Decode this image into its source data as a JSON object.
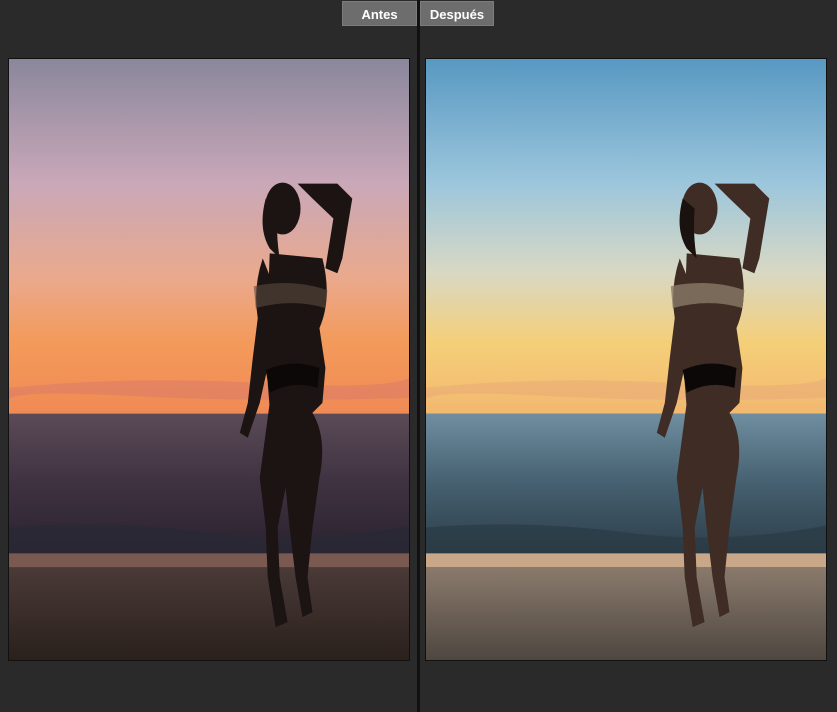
{
  "compare": {
    "before_label": "Antes",
    "after_label": "Después"
  },
  "images": {
    "before": {
      "description_icon": "photo-before-image",
      "sky_top": "#8f8ba0",
      "sky_mid": "#d8a8a8",
      "horizon": "#f2a55e",
      "sea": "#3d2f3a",
      "sand": "#2e2420",
      "figure": "#1a1210"
    },
    "after": {
      "description_icon": "photo-after-image",
      "sky_top": "#5c9cc6",
      "sky_mid": "#b9d6e4",
      "horizon": "#f5c979",
      "sea": "#3c4e5c",
      "sand": "#5a5048",
      "figure": "#3d2a22"
    }
  }
}
